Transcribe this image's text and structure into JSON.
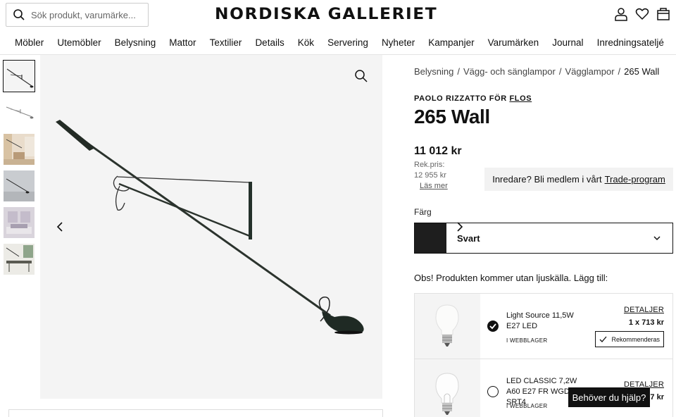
{
  "header": {
    "search_placeholder": "Sök produkt, varumärke...",
    "logo": "NORDISKA GALLERIET",
    "icons": [
      "user-icon",
      "heart-icon",
      "bag-icon"
    ]
  },
  "nav": {
    "items": [
      "Möbler",
      "Utemöbler",
      "Belysning",
      "Mattor",
      "Textilier",
      "Details",
      "Kök",
      "Servering",
      "Nyheter",
      "Kampanjer",
      "Varumärken",
      "Journal",
      "Inredningsateljé"
    ]
  },
  "gallery": {
    "thumbnail_count": 6,
    "active_index": 0
  },
  "product": {
    "breadcrumb": [
      "Belysning",
      "Vägg- och sänglampor",
      "Vägglampor",
      "265 Wall"
    ],
    "designer_prefix": "PAOLO RIZZATTO FÖR",
    "brand": "FLOS",
    "title": "265 Wall",
    "price": "11 012 kr",
    "rek_label": "Rek.pris:",
    "rek_value": "12 955 kr",
    "read_more": "Läs mer",
    "trade_text": "Inredare? Bli medlem i vårt",
    "trade_link": "Trade-program",
    "color_label": "Färg",
    "color_value": "Svart",
    "color_swatch": "#1e1e1e",
    "notice": "Obs! Produkten kommer utan ljuskälla. Lägg till:"
  },
  "addons": [
    {
      "name": "Light Source 11,5W E27 LED",
      "stock": "I WEBBLAGER",
      "details": "DETALJER",
      "qty_price": "1 x 713 kr",
      "recommended": "Rekommenderas",
      "selected": true
    },
    {
      "name": "LED CLASSIC 7,2W A60 E27 FR WGD90 SRT4",
      "stock": "I WEBBLAGER",
      "details": "DETALJER",
      "qty_price": "1 x 137 kr",
      "selected": false
    }
  ],
  "help_button": "Behöver du hjälp?"
}
